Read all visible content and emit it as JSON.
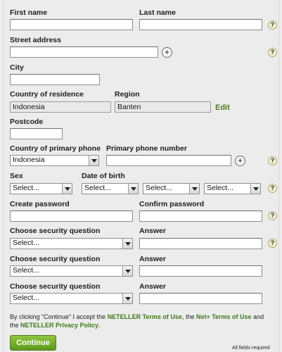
{
  "labels": {
    "first_name": "First name",
    "last_name": "Last name",
    "street_address": "Street address",
    "city": "City",
    "country_residence": "Country of residence",
    "region": "Region",
    "postcode": "Postcode",
    "country_phone": "Country of primary phone",
    "primary_phone": "Primary phone number",
    "sex": "Sex",
    "dob": "Date of birth",
    "create_password": "Create password",
    "confirm_password": "Confirm password",
    "security_q1": "Choose security question",
    "answer1": "Answer",
    "security_q2": "Choose security question",
    "answer2": "Answer",
    "security_q3": "Choose security question",
    "answer3": "Answer"
  },
  "values": {
    "country_residence": "Indonesia",
    "region": "Banten",
    "country_phone": "Indonesia",
    "sex": "Select...",
    "dob_day": "Select...",
    "dob_month": "Select...",
    "dob_year": "Select...",
    "security_q1": "Select...",
    "security_q2": "Select...",
    "security_q3": "Select..."
  },
  "edit_link": "Edit",
  "help_glyph": "?",
  "plus_glyph": "+",
  "terms": {
    "prefix": "By clicking “Continue” I accept the ",
    "link1": "NETELLER Terms of Use",
    "mid": ", the ",
    "link2": "Net+ Terms of Use",
    "and": " and the ",
    "link3": "NETELLER Privacy Policy",
    "suffix": "."
  },
  "continue_label": "Continue",
  "required_note": "All fields required",
  "colors": {
    "accent_green": "#5d9a1c",
    "link_green": "#3c7a17",
    "background": "#ececec"
  }
}
